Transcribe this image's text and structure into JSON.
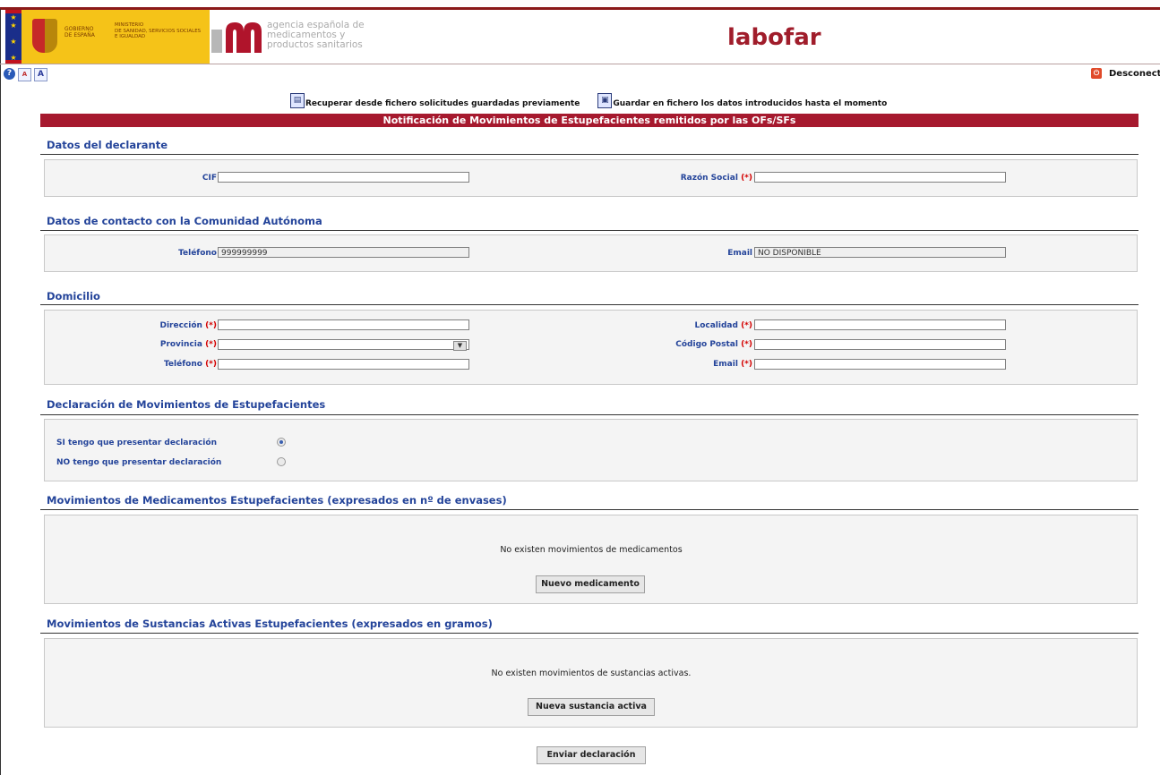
{
  "header": {
    "gov_line1": "GOBIERNO",
    "gov_line2": "DE ESPAÑA",
    "ministry_line1": "MINISTERIO",
    "ministry_line2": "DE SANIDAD, SERVICIOS SOCIALES",
    "ministry_line3": "E IGUALDAD",
    "agency_line1": "agencia española de",
    "agency_line2": "medicamentos y",
    "agency_line3": "productos sanitarios",
    "brand": "labofar"
  },
  "toolbar": {
    "help_glyph": "?",
    "font_small_glyph": "A",
    "font_large_glyph": "A",
    "disconnect_label": "Desconectar"
  },
  "filebar": {
    "recover_label": "Recuperar desde fichero solicitudes guardadas previamente",
    "save_label": "Guardar en fichero los datos introducidos hasta el momento"
  },
  "form_title": "Notificación de Movimientos de Estupefacientes remitidos por las OFs/SFs",
  "sections": {
    "declarante": {
      "title": "Datos del declarante",
      "cif_label": "CIF",
      "cif_value": "",
      "razon_label": "Razón Social",
      "razon_value": ""
    },
    "contacto": {
      "title": "Datos de contacto con la Comunidad Autónoma",
      "telefono_label": "Teléfono",
      "telefono_value": "999999999",
      "email_label": "Email",
      "email_value": "NO DISPONIBLE"
    },
    "domicilio": {
      "title": "Domicilio",
      "direccion_label": "Dirección",
      "provincia_label": "Provincia",
      "telefono_label": "Teléfono",
      "localidad_label": "Localidad",
      "cp_label": "Código Postal",
      "email_label": "Email",
      "direccion_value": "",
      "provincia_value": "",
      "telefono_value": "",
      "localidad_value": "",
      "cp_value": "",
      "email_value": ""
    },
    "declaracion": {
      "title": "Declaración de Movimientos de Estupefacientes",
      "si_label": "SI tengo que presentar declaración",
      "no_label": "NO tengo que presentar declaración",
      "selected": "si"
    },
    "medicamentos": {
      "title": "Movimientos de Medicamentos Estupefacientes (expresados en nº de envases)",
      "empty_msg": "No existen movimientos de medicamentos",
      "button": "Nuevo medicamento"
    },
    "sustancias": {
      "title": "Movimientos de Sustancias Activas Estupefacientes (expresados en gramos)",
      "empty_msg": "No existen movimientos de sustancias activas.",
      "button": "Nueva sustancia activa"
    }
  },
  "required_marker": "(*)",
  "select_arrow": "▼",
  "submit_button": "Enviar declaración"
}
